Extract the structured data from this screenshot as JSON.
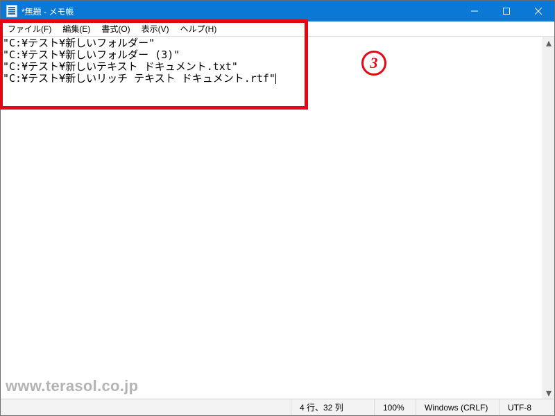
{
  "titlebar": {
    "title": "*無題 - メモ帳"
  },
  "menus": {
    "file": "ファイル(F)",
    "edit": "編集(E)",
    "format": "書式(O)",
    "view": "表示(V)",
    "help": "ヘルプ(H)"
  },
  "document": {
    "lines": [
      "\"C:¥テスト¥新しいフォルダー\"",
      "\"C:¥テスト¥新しいフォルダー (3)\"",
      "\"C:¥テスト¥新しいテキスト ドキュメント.txt\"",
      "\"C:¥テスト¥新しいリッチ テキスト ドキュメント.rtf\""
    ]
  },
  "status": {
    "position": "4 行、32 列",
    "zoom": "100%",
    "lineending": "Windows (CRLF)",
    "encoding": "UTF-8"
  },
  "annotations": {
    "callout_number": "3"
  },
  "watermark": "www.terasol.co.jp"
}
